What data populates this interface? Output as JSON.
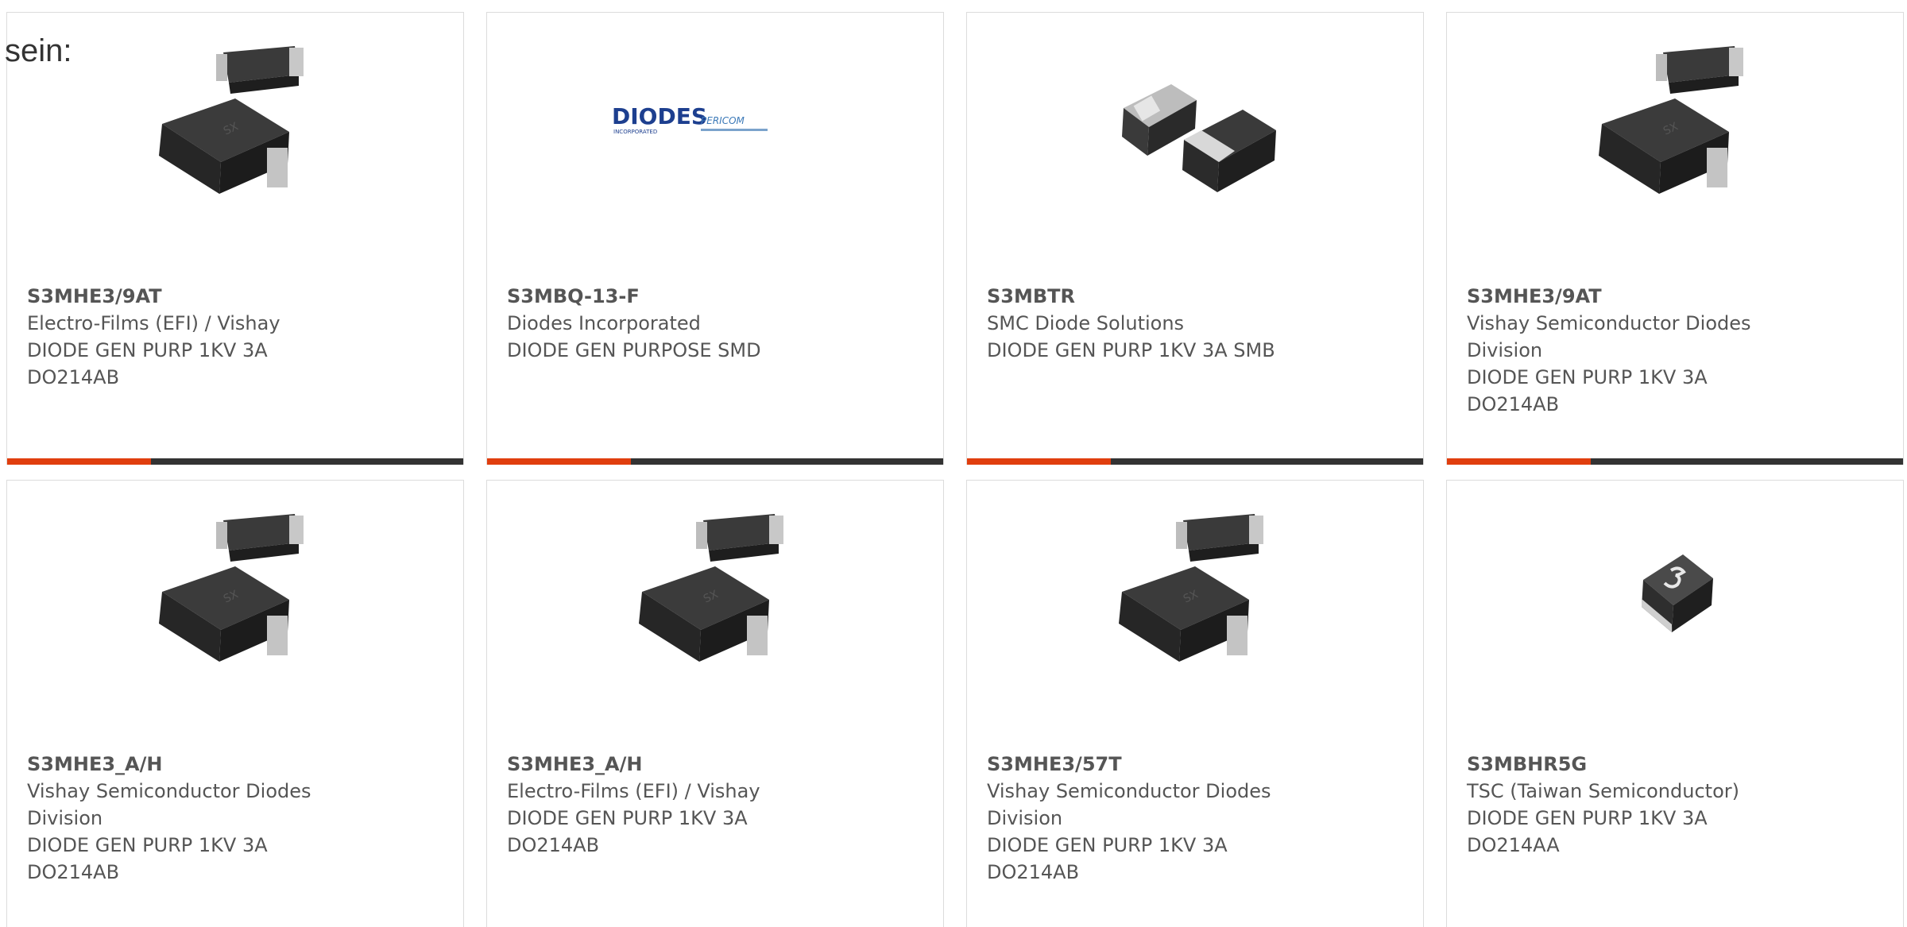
{
  "intro_text": "sein:",
  "colors": {
    "accent": "#e03e0e",
    "bar": "#333333",
    "text": "#555555",
    "border": "#dcdcdc"
  },
  "products": [
    {
      "part": "S3MHE3/9AT",
      "lines": [
        "Electro-Films (EFI) / Vishay",
        "DIODE GEN PURP 1KV 3A",
        "DO214AB"
      ],
      "image": "smd-diode-pair-image"
    },
    {
      "part": "S3MBQ-13-F",
      "lines": [
        "Diodes Incorporated",
        "DIODE GEN PURPOSE SMD"
      ],
      "image": "diodes-pericom-logo",
      "logo_text": "DIODES",
      "logo_subtext": "INCORPORATED",
      "logo_text2": "PERICOM"
    },
    {
      "part": "S3MBTR",
      "lines": [
        "SMC Diode Solutions",
        "DIODE GEN PURP 1KV 3A SMB"
      ],
      "image": "smd-diode-pair-image"
    },
    {
      "part": "S3MHE3/9AT",
      "lines": [
        "Vishay Semiconductor Diodes",
        "Division",
        "DIODE GEN PURP 1KV 3A",
        "DO214AB"
      ],
      "image": "smd-diode-pair-image"
    },
    {
      "part": "S3MHE3_A/H",
      "lines": [
        "Vishay Semiconductor Diodes",
        "Division",
        "DIODE GEN PURP 1KV 3A",
        "DO214AB"
      ],
      "image": "smd-diode-pair-image"
    },
    {
      "part": "S3MHE3_A/H",
      "lines": [
        "Electro-Films (EFI) / Vishay",
        "DIODE GEN PURP 1KV 3A",
        "DO214AB"
      ],
      "image": "smd-diode-pair-image"
    },
    {
      "part": "S3MHE3/57T",
      "lines": [
        "Vishay Semiconductor Diodes",
        "Division",
        "DIODE GEN PURP 1KV 3A",
        "DO214AB"
      ],
      "image": "smd-diode-pair-image"
    },
    {
      "part": "S3MBHR5G",
      "lines": [
        "TSC (Taiwan Semiconductor)",
        "DIODE GEN PURP 1KV 3A",
        "DO214AA"
      ],
      "image": "smd-diode-single-image"
    }
  ]
}
